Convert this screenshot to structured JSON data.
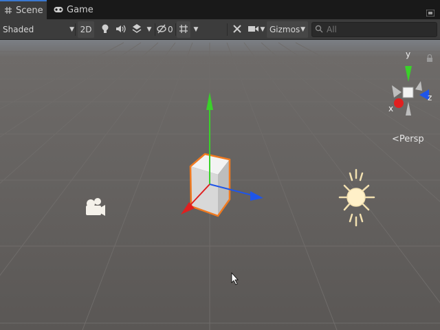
{
  "tabs": [
    {
      "label": "Scene",
      "icon": "grid-hash-icon",
      "active": true
    },
    {
      "label": "Game",
      "icon": "gamepad-icon",
      "active": false
    }
  ],
  "toolbar": {
    "draw_mode": "Shaded",
    "mode_2d": "2D",
    "hidden_count": "0",
    "gizmos_label": "Gizmos",
    "search_placeholder": "All"
  },
  "gizmo": {
    "axis_y": "y",
    "axis_x": "x",
    "axis_z": "z",
    "projection": "Persp"
  },
  "colors": {
    "accent_tab": "#3a78d0",
    "axis_x": "#e01f1f",
    "axis_y": "#3ad12a",
    "axis_z": "#1f55e8",
    "selection": "#f07a20"
  }
}
